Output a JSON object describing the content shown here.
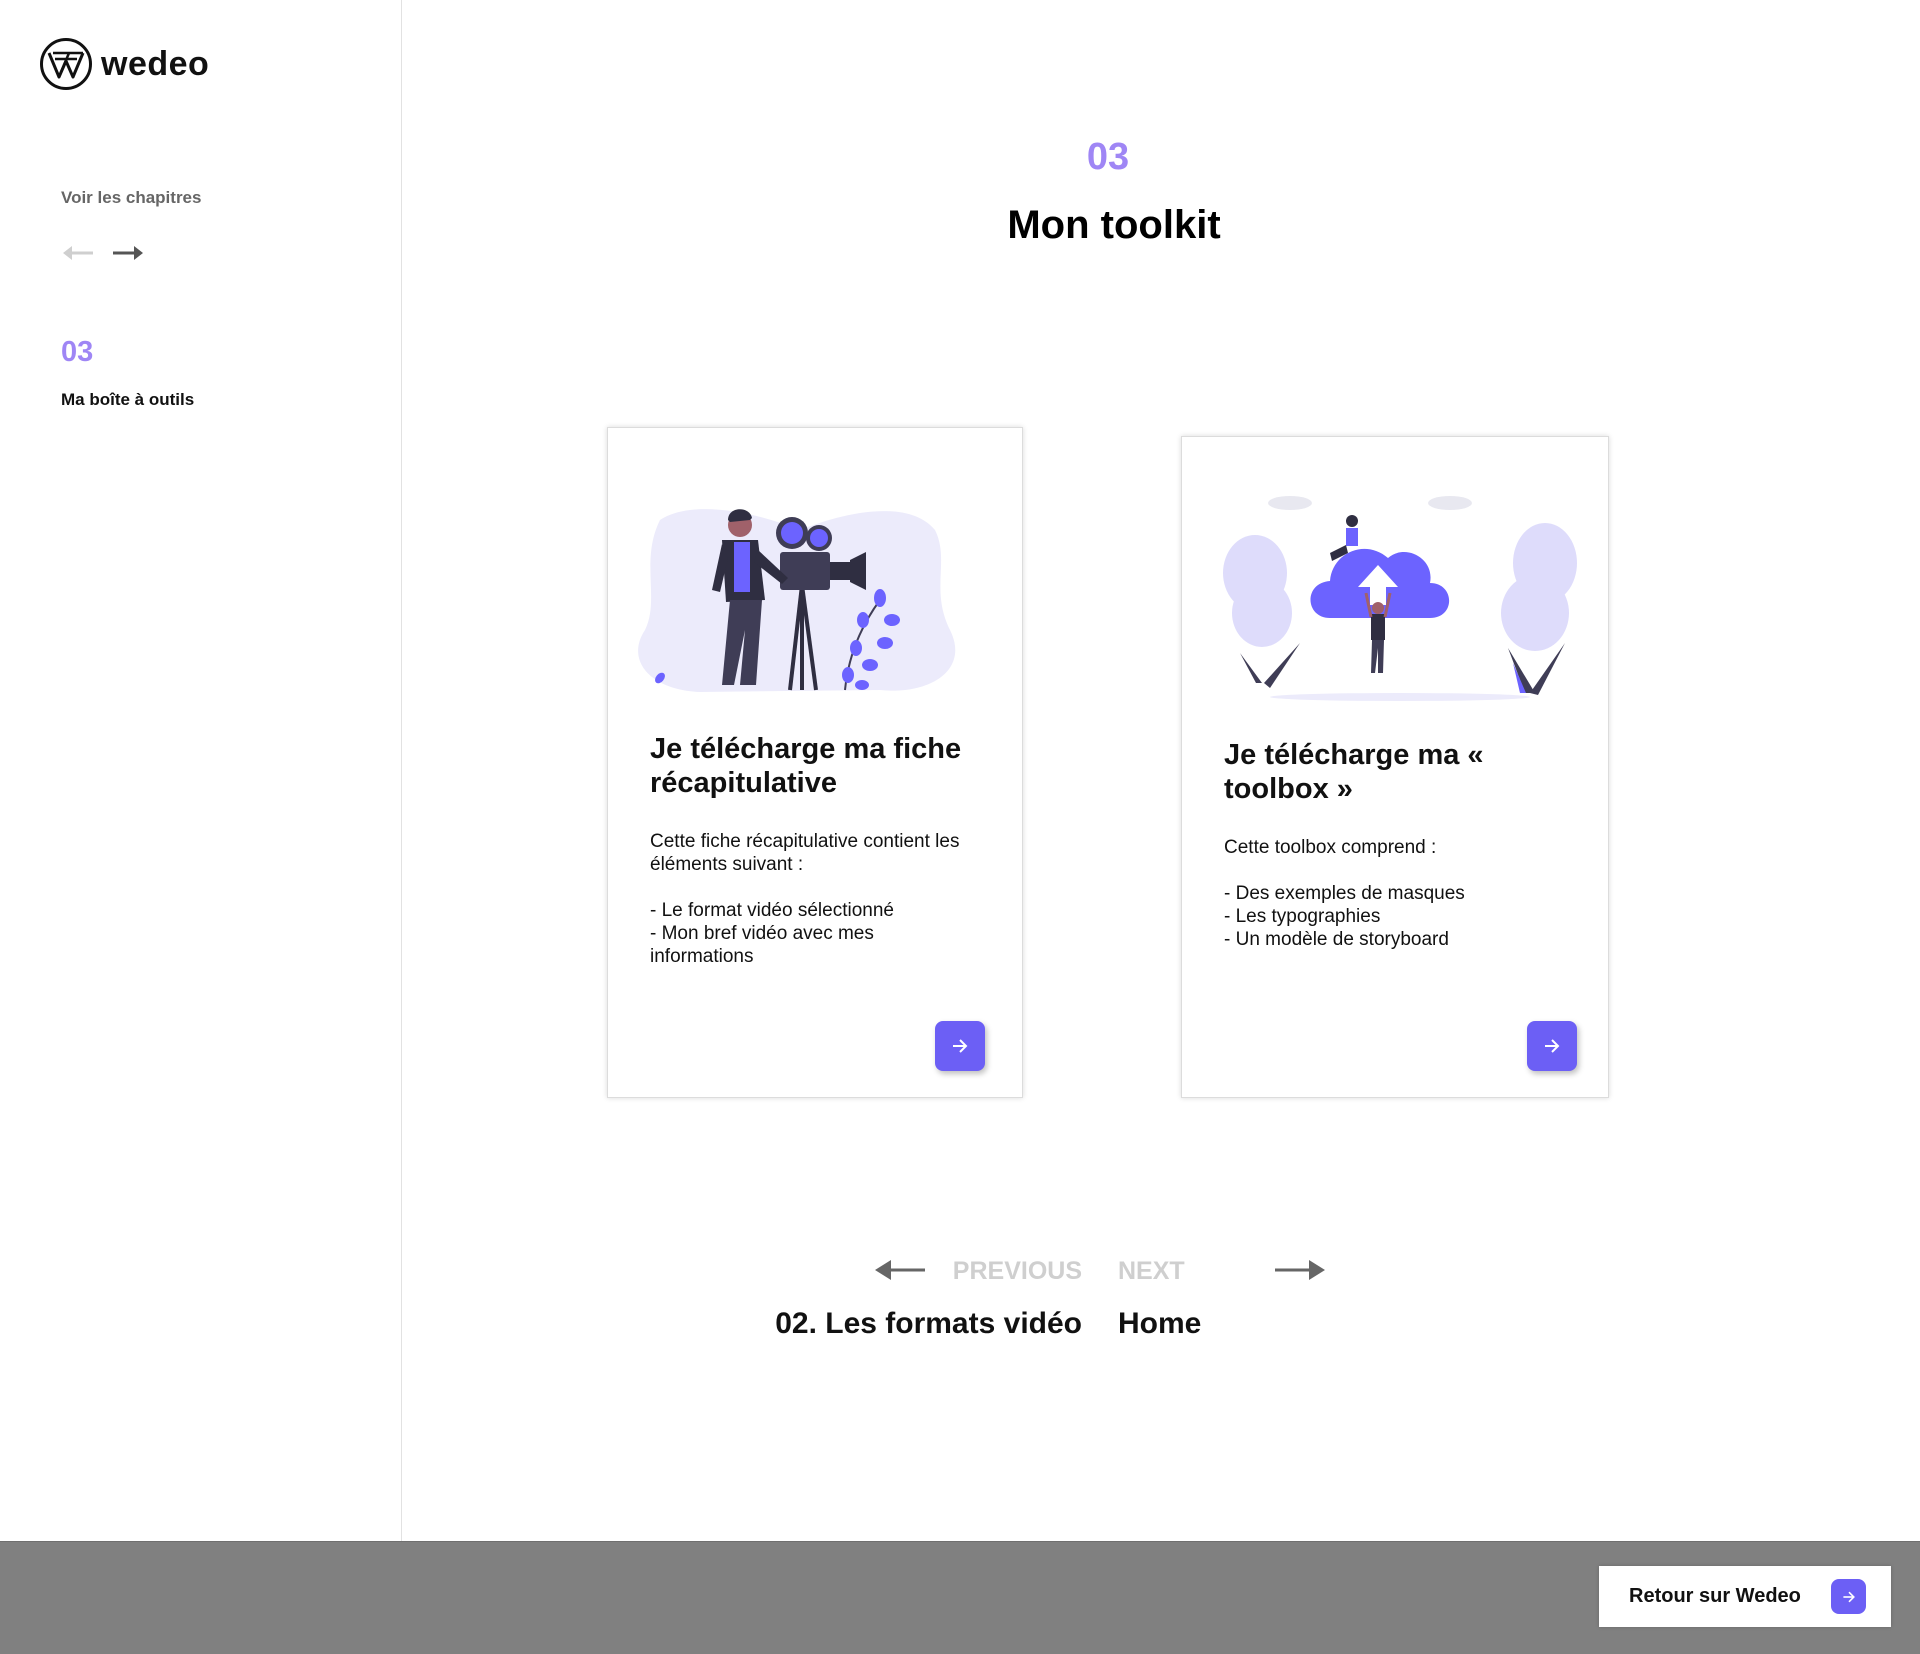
{
  "brand": {
    "name": "wedeo"
  },
  "sidebar": {
    "chapters_label": "Voir les chapitres",
    "current_number": "03",
    "current_title": "Ma boîte à outils"
  },
  "header": {
    "chapter_number": "03",
    "title": "Mon toolkit"
  },
  "cards": [
    {
      "title": "Je télécharge ma fiche récapitulative",
      "description": "Cette fiche récapitulative contient les éléments suivant :",
      "items": [
        "- Le format vidéo sélectionné",
        "- Mon bref vidéo avec mes informations"
      ]
    },
    {
      "title": "Je télécharge ma « toolbox »",
      "description": "Cette toolbox comprend :",
      "items": [
        "- Des exemples de masques",
        "- Les typographies",
        "- Un modèle de storyboard"
      ]
    }
  ],
  "pagination": {
    "previous_label": "PREVIOUS",
    "previous_title": "02. Les formats vidéo",
    "next_label": "NEXT",
    "next_title": "Home"
  },
  "footer": {
    "back_label": "Retour sur Wedeo"
  },
  "colors": {
    "accent": "#6c5ff5",
    "accent_light": "#9f86f5",
    "footer_bg": "#808080"
  }
}
